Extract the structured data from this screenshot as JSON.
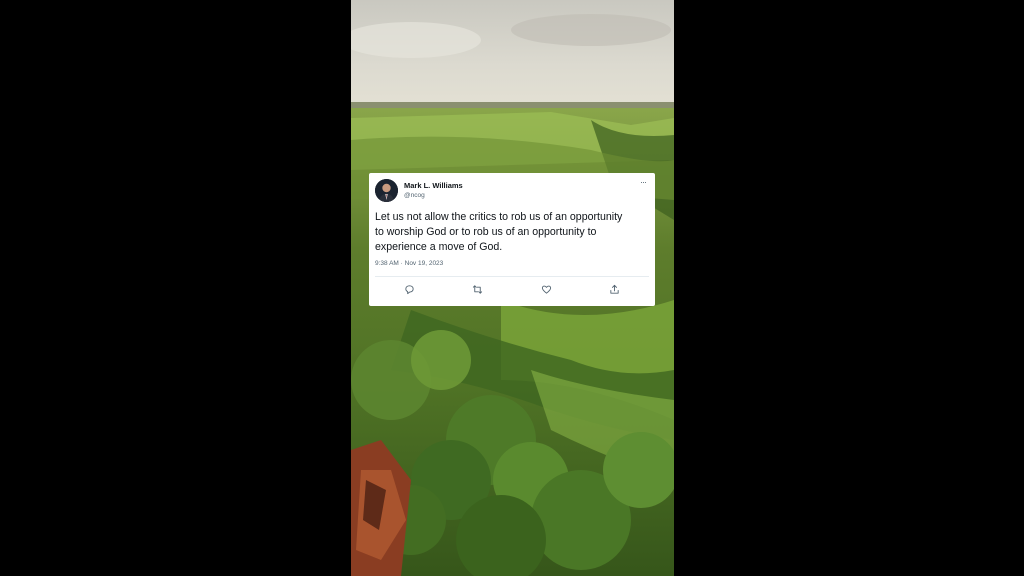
{
  "background": {
    "letterbox_color": "#000000",
    "scene": "aerial-green-valley"
  },
  "tweet": {
    "author_name": "Mark L. Williams",
    "author_handle": "@ncog",
    "text_lines": [
      "Let us not allow the critics to rob us of an opportunity",
      "to worship God or to rob us of an opportunity to",
      "experience a move of God."
    ],
    "timestamp": "9:38 AM · Nov 19, 2023",
    "more_icon": "ellipsis-icon",
    "actions": [
      "reply-icon",
      "retweet-icon",
      "like-icon",
      "share-icon"
    ]
  }
}
